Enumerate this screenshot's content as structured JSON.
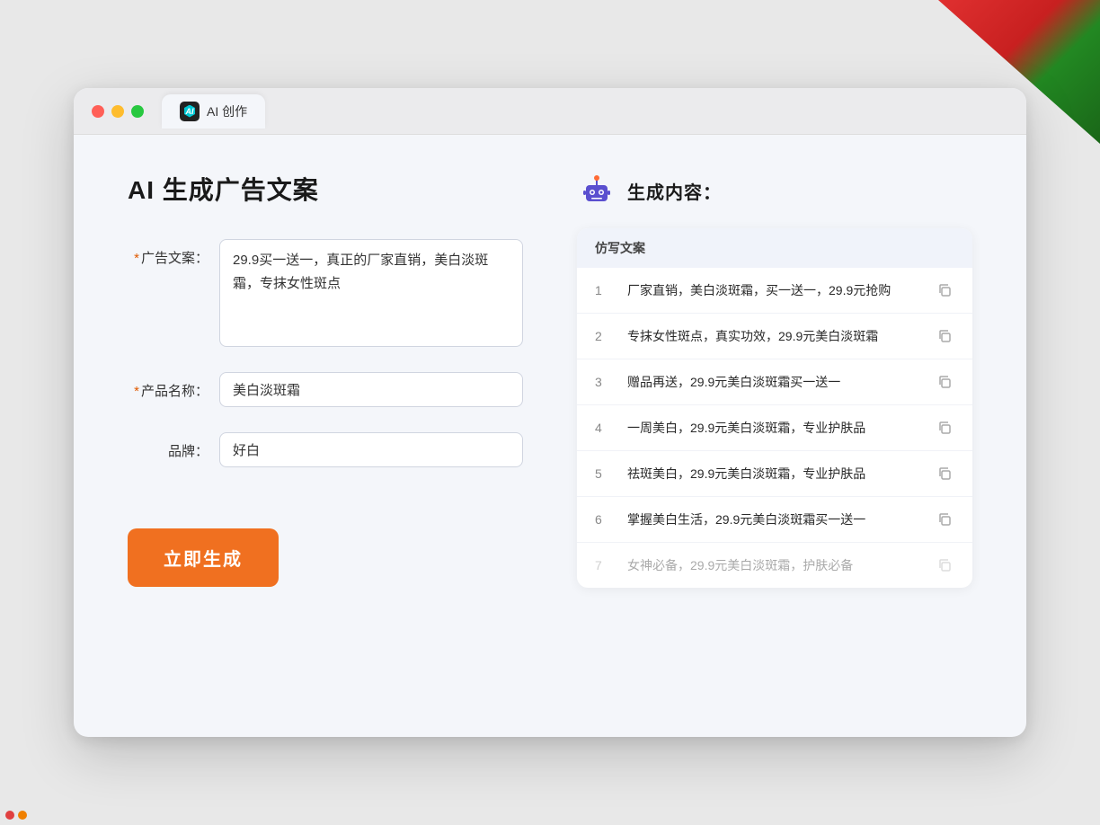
{
  "window": {
    "traffic_lights": [
      "red",
      "yellow",
      "green"
    ],
    "tab_icon_text": "AI",
    "tab_label": "AI 创作"
  },
  "left": {
    "page_title": "AI 生成广告文案",
    "form": {
      "ad_copy_label": "广告文案：",
      "ad_copy_required": "*",
      "ad_copy_value": "29.9买一送一，真正的厂家直销，美白淡斑霜，专抹女性斑点",
      "product_name_label": "产品名称：",
      "product_name_required": "*",
      "product_name_value": "美白淡斑霜",
      "brand_label": "品牌：",
      "brand_value": "好白"
    },
    "generate_button": "立即生成"
  },
  "right": {
    "section_title": "生成内容：",
    "table_header": "仿写文案",
    "results": [
      {
        "number": 1,
        "text": "厂家直销，美白淡斑霜，买一送一，29.9元抢购"
      },
      {
        "number": 2,
        "text": "专抹女性斑点，真实功效，29.9元美白淡斑霜"
      },
      {
        "number": 3,
        "text": "赠品再送，29.9元美白淡斑霜买一送一"
      },
      {
        "number": 4,
        "text": "一周美白，29.9元美白淡斑霜，专业护肤品"
      },
      {
        "number": 5,
        "text": "祛斑美白，29.9元美白淡斑霜，专业护肤品"
      },
      {
        "number": 6,
        "text": "掌握美白生活，29.9元美白淡斑霜买一送一"
      },
      {
        "number": 7,
        "text": "女神必备，29.9元美白淡斑霜，护肤必备",
        "dimmed": true
      }
    ]
  }
}
